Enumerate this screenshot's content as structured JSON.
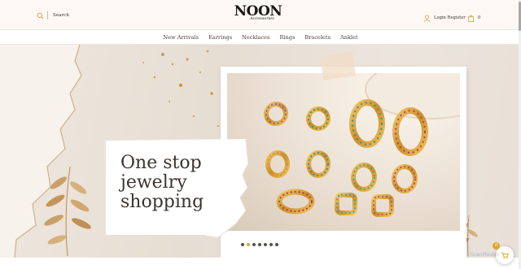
{
  "header": {
    "search_label": "Search",
    "logo_main": "NOON",
    "logo_sub": "Accessories",
    "account_label": "Login Register",
    "cart_count": "0"
  },
  "nav": {
    "items": [
      "New Arrivals",
      "Earrings",
      "Necklaces",
      "Rings",
      "Bracelets",
      "Anklet"
    ]
  },
  "hero": {
    "headline_lines": [
      "One stop",
      "jewelry",
      "shopping"
    ],
    "slide_count": 7,
    "active_slide": 2
  },
  "floating_cart": {
    "count": "0"
  },
  "watermark": "ScanMaster",
  "colors": {
    "accent_gold": "#d2a73a",
    "header_bg": "#fdf8f3",
    "text_dark": "#3a3431"
  },
  "icons": [
    "search-icon",
    "user-icon",
    "shopping-bag-icon",
    "cart-icon"
  ]
}
